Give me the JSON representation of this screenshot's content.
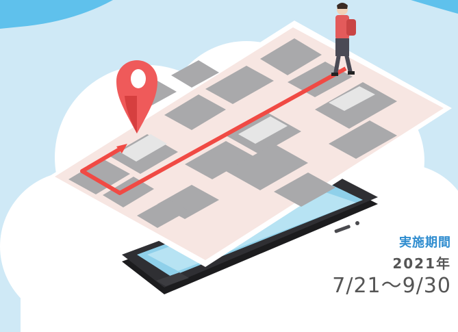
{
  "colors": {
    "sky": "#cfe9f6",
    "cloud": "#ffffff",
    "banner": "#5fc1ec",
    "accent_blue": "#2e8ccf",
    "route": "#f04a44",
    "pin": "#ef5a5a",
    "map_sheet": "#f7e6e2",
    "block_gray": "#a9a9ab",
    "phone_body": "#2a2a2d",
    "phone_screen": "#8fd0ea",
    "text_gray": "#555555"
  },
  "icons": [
    "location-pin-icon",
    "walking-person-icon",
    "smartphone-icon",
    "route-arrow-icon",
    "cloud-shape"
  ],
  "campaign_period": {
    "label": "実施期間",
    "year": "2021年",
    "dates": "7/21〜9/30"
  }
}
